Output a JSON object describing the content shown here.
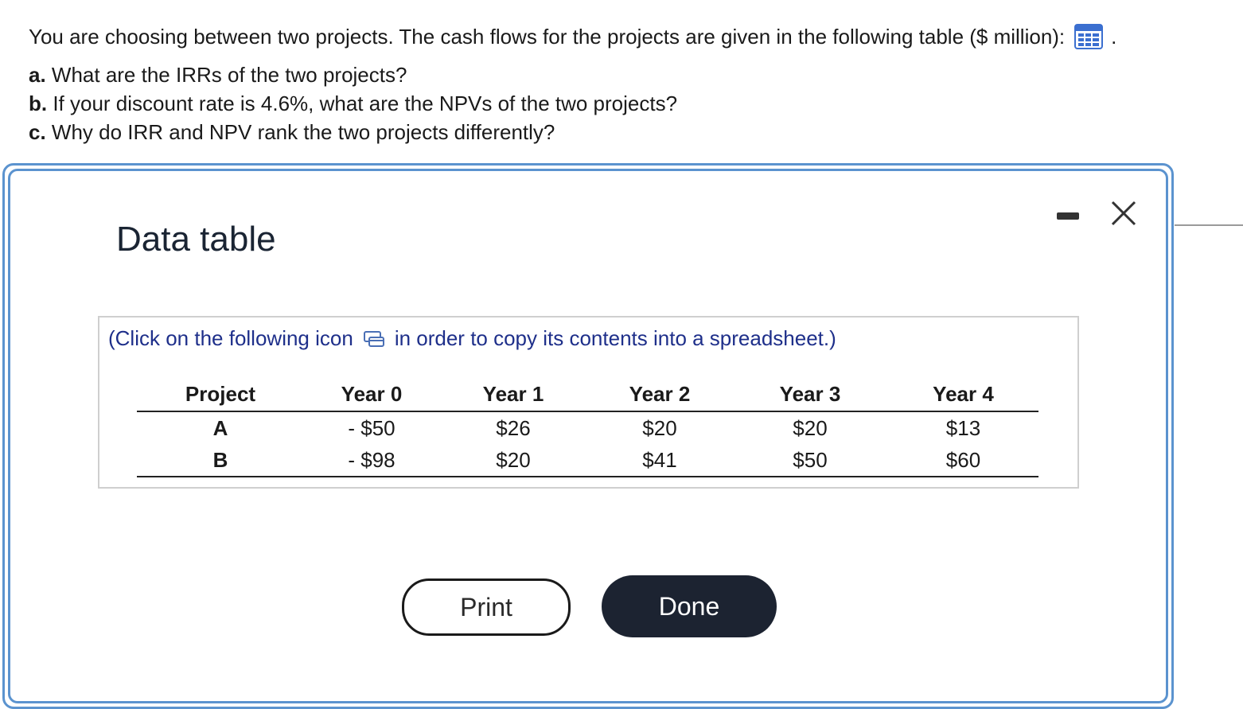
{
  "question": {
    "intro": "You are choosing between two projects. The cash flows for the projects are given in the following table ($ million):",
    "trailing": ".",
    "parts": [
      {
        "label": "a.",
        "text": " What are the IRRs of the two projects?"
      },
      {
        "label": "b.",
        "text": " If your discount rate is 4.6%, what are the NPVs of the two projects?"
      },
      {
        "label": "c.",
        "text": " Why do IRR and NPV rank the two projects differently?"
      }
    ],
    "table_icon": "grid-table-icon"
  },
  "dialog": {
    "title": "Data table",
    "minimize_icon": "minimize-icon",
    "close_icon": "close-icon",
    "accent_color": "#5b93cf"
  },
  "data_table": {
    "note_before": "(Click on the following icon",
    "note_after": "in order to copy its contents into a spreadsheet.)",
    "copy_icon": "copy-spreadsheet-icon",
    "note_color": "#1e2f8a",
    "headers": [
      "Project",
      "Year 0",
      "Year 1",
      "Year 2",
      "Year 3",
      "Year 4"
    ],
    "rows": [
      [
        "A",
        "- $50",
        "$26",
        "$20",
        "$20",
        "$13"
      ],
      [
        "B",
        "- $98",
        "$20",
        "$41",
        "$50",
        "$60"
      ]
    ]
  },
  "buttons": {
    "print": "Print",
    "done": "Done",
    "done_color": "#1c2331"
  }
}
